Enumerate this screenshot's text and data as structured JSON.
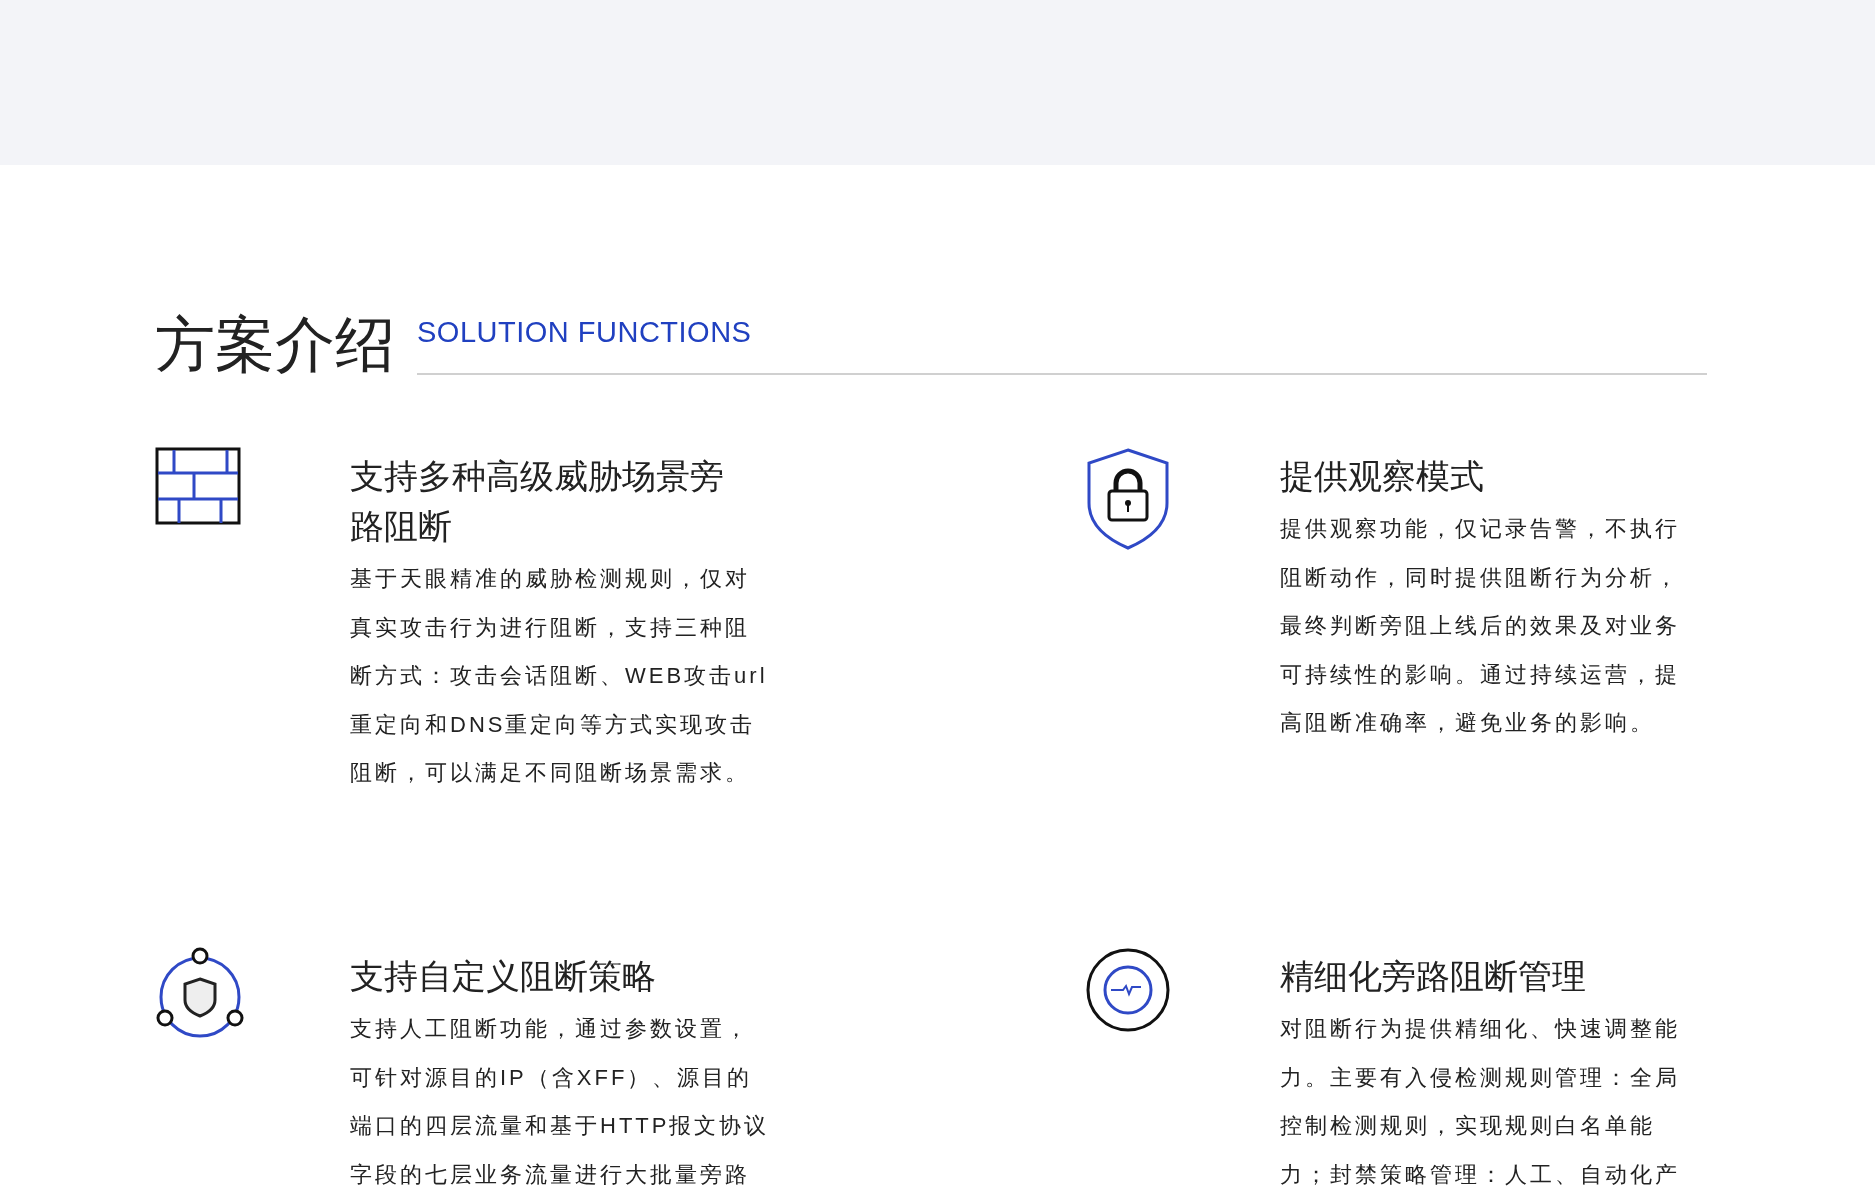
{
  "section": {
    "title": "方案介绍",
    "subtitle": "SOLUTION FUNCTIONS"
  },
  "features": [
    {
      "kind": "wall",
      "title": "支持多种高级威胁场景旁路阻断",
      "body": "基于天眼精准的威胁检测规则，仅对真实攻击行为进行阻断，支持三种阻断方式：攻击会话阻断、WEB攻击url重定向和DNS重定向等方式实现攻击阻断，可以满足不同阻断场景需求。"
    },
    {
      "kind": "lock",
      "title": "提供观察模式",
      "body": "提供观察功能，仅记录告警，不执行阻断动作，同时提供阻断行为分析，最终判断旁阻上线后的效果及对业务可持续性的影响。通过持续运营，提高阻断准确率，避免业务的影响。"
    },
    {
      "kind": "network",
      "title": "支持自定义阻断策略",
      "body": "支持人工阻断功能，通过参数设置，可针对源目的IP（含XFF）、源目的端口的四层流量和基于HTTP报文协议字段的七层业务流量进行大批量旁路"
    },
    {
      "kind": "pulse",
      "title": "精细化旁路阻断管理",
      "body": "对阻断行为提供精细化、快速调整能力。主要有入侵检测规则管理：全局控制检测规则，实现规则白名单能力；封禁策略管理：人工、自动化产"
    }
  ]
}
